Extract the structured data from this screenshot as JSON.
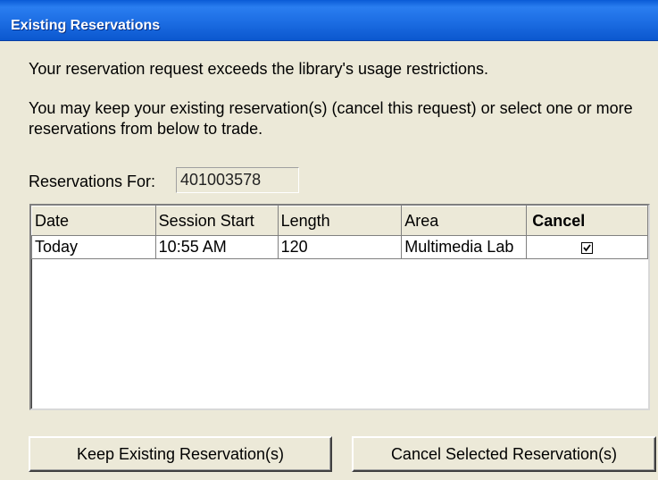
{
  "window": {
    "title": "Existing Reservations"
  },
  "messages": {
    "restriction": "Your reservation request exceeds the library's usage restrictions.",
    "options": "You may keep your existing reservation(s) (cancel this request) or select one or more reservations from below to trade."
  },
  "reservations_for": {
    "label": "Reservations For:",
    "value": "401003578"
  },
  "table": {
    "columns": [
      "Date",
      "Session Start",
      "Length",
      "Area",
      "Cancel"
    ],
    "rows": [
      {
        "date": "Today",
        "session_start": "10:55 AM",
        "length": "120",
        "area": "Multimedia Lab",
        "cancel_checked": true
      }
    ]
  },
  "buttons": {
    "keep_label": "Keep Existing Reservation(s)",
    "cancel_label": "Cancel Selected Reservation(s)"
  },
  "colors": {
    "titlebar": "#0a5bd6",
    "dialog_bg": "#ece9d8"
  }
}
